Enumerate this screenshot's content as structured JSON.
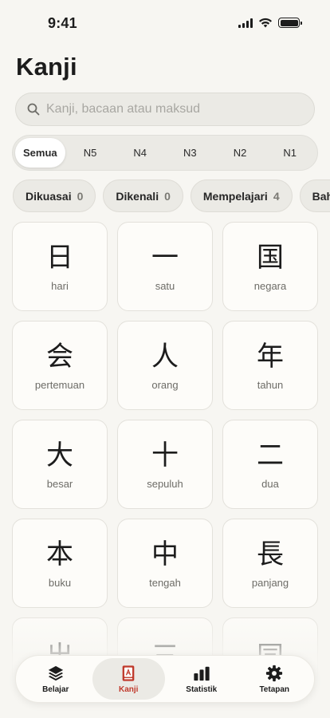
{
  "status_bar": {
    "time": "9:41"
  },
  "page": {
    "title": "Kanji"
  },
  "search": {
    "placeholder": "Kanji, bacaan atau maksud",
    "value": ""
  },
  "levels": [
    {
      "label": "Semua",
      "active": true
    },
    {
      "label": "N5",
      "active": false
    },
    {
      "label": "N4",
      "active": false
    },
    {
      "label": "N3",
      "active": false
    },
    {
      "label": "N2",
      "active": false
    },
    {
      "label": "N1",
      "active": false
    }
  ],
  "filters": [
    {
      "label": "Dikuasai",
      "count": "0"
    },
    {
      "label": "Dikenali",
      "count": "0"
    },
    {
      "label": "Mempelajari",
      "count": "4"
    },
    {
      "label": "Bah",
      "count": ""
    }
  ],
  "kanji": [
    {
      "char": "日",
      "meaning": "hari"
    },
    {
      "char": "一",
      "meaning": "satu"
    },
    {
      "char": "国",
      "meaning": "negara"
    },
    {
      "char": "会",
      "meaning": "pertemuan"
    },
    {
      "char": "人",
      "meaning": "orang"
    },
    {
      "char": "年",
      "meaning": "tahun"
    },
    {
      "char": "大",
      "meaning": "besar"
    },
    {
      "char": "十",
      "meaning": "sepuluh"
    },
    {
      "char": "二",
      "meaning": "dua"
    },
    {
      "char": "本",
      "meaning": "buku"
    },
    {
      "char": "中",
      "meaning": "tengah"
    },
    {
      "char": "長",
      "meaning": "panjang"
    },
    {
      "char": "出",
      "meaning": ""
    },
    {
      "char": "三",
      "meaning": ""
    },
    {
      "char": "同",
      "meaning": ""
    }
  ],
  "tab_bar": [
    {
      "label": "Belajar",
      "icon": "layers-icon",
      "active": false
    },
    {
      "label": "Kanji",
      "icon": "kanji-book-icon",
      "active": true
    },
    {
      "label": "Statistik",
      "icon": "bar-chart-icon",
      "active": false
    },
    {
      "label": "Tetapan",
      "icon": "gear-icon",
      "active": false
    }
  ],
  "colors": {
    "accent": "#c0392b",
    "background": "#f7f6f2",
    "card": "#fdfcf9"
  }
}
